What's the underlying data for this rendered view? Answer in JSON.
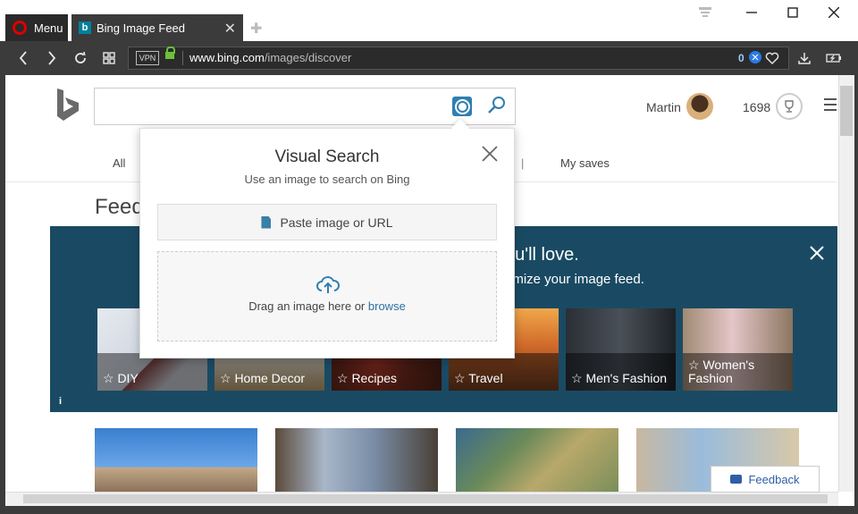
{
  "browser": {
    "menu_label": "Menu",
    "tab_title": "Bing Image Feed",
    "url_domain": "www.bing.com",
    "url_path": "/images/discover",
    "vpn_label": "VPN",
    "blocked_count": "0"
  },
  "header": {
    "user_name": "Martin",
    "reward_points": "1698"
  },
  "subnav": {
    "all_label": "All",
    "separator": "|",
    "my_saves_label": "My saves"
  },
  "feed": {
    "title": "Feed",
    "banner_heading": "ou'll love.",
    "banner_subtext": "omize your image feed.",
    "info_label": "i",
    "categories": [
      {
        "label": "☆ DIY"
      },
      {
        "label": "☆ Home Decor"
      },
      {
        "label": "☆ Recipes"
      },
      {
        "label": "☆ Travel"
      },
      {
        "label": "☆ Men's Fashion"
      },
      {
        "label": "☆ Women's Fashion"
      }
    ]
  },
  "visual_search": {
    "title": "Visual Search",
    "subtitle": "Use an image to search on Bing",
    "paste_label": "Paste image or URL",
    "drop_text": "Drag an image here or",
    "browse_link": "browse"
  },
  "feedback_label": "Feedback",
  "colors": {
    "banner": "#1a4a63",
    "accent": "#2f7fb0",
    "browser_chrome": "#3b3b3b"
  }
}
